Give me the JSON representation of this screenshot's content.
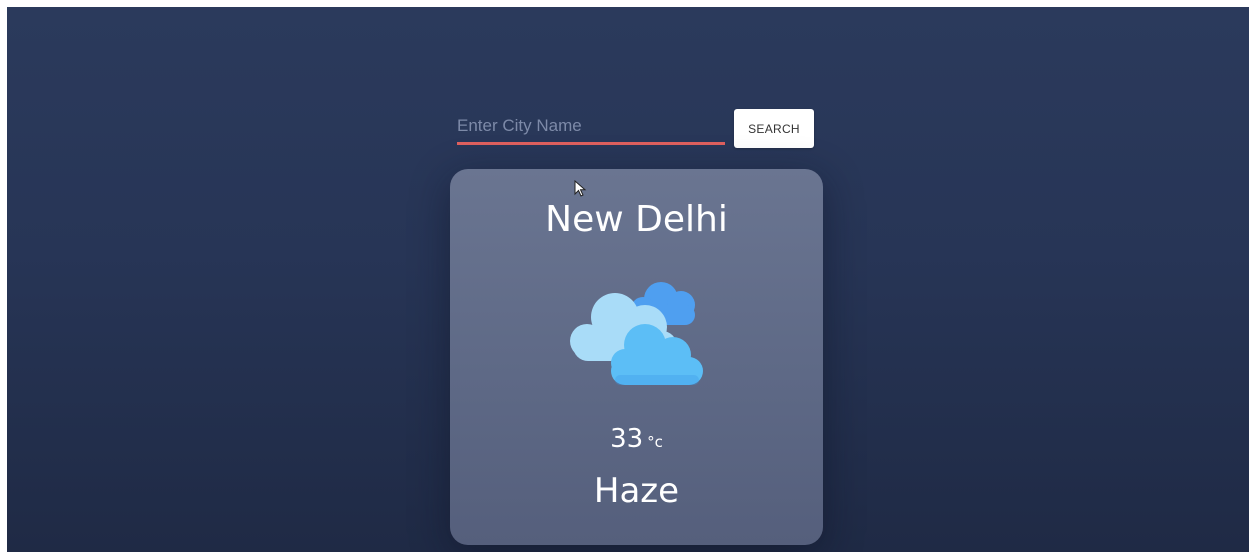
{
  "search": {
    "placeholder": "Enter City Name",
    "value": "",
    "button_label": "SEARCH",
    "underline_color": "#e0615f"
  },
  "weather": {
    "city": "New Delhi",
    "icon": "cloudy-icon",
    "temperature": "33",
    "unit": "°c",
    "condition": "Haze"
  },
  "colors": {
    "background": "#273556",
    "card": "#636e8b",
    "cloud_front": "#5bbdf5",
    "cloud_mid": "#a8defa",
    "cloud_back": "#4a9ef0"
  }
}
